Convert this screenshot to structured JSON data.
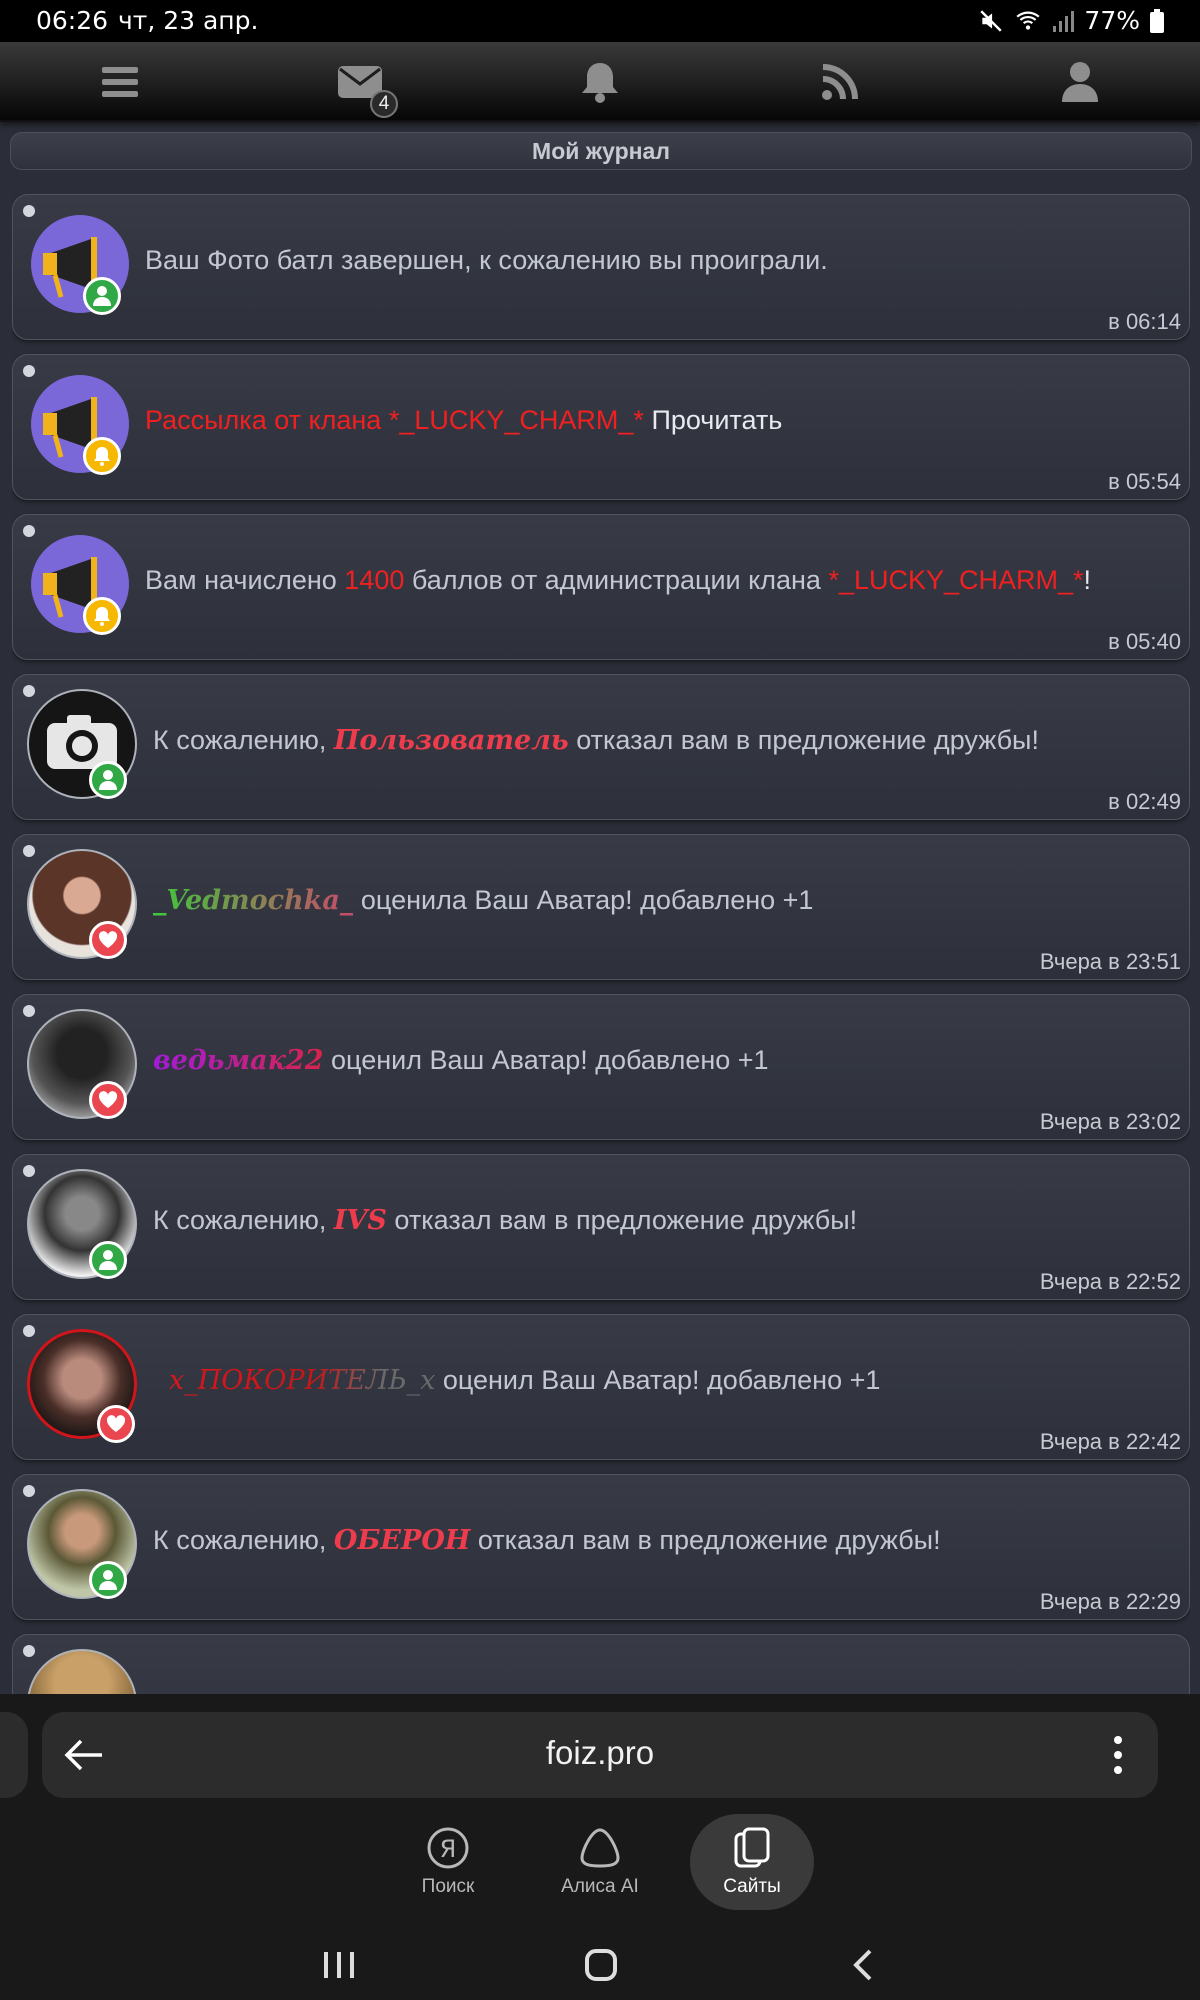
{
  "status": {
    "time": "06:26",
    "date": "чт, 23 апр.",
    "battery": "77%"
  },
  "nav": {
    "mail_badge": "4",
    "icons": [
      "menu-icon",
      "mail-icon",
      "bell-icon",
      "rss-icon",
      "user-icon"
    ]
  },
  "page": {
    "title": "Мой журнал"
  },
  "items": [
    {
      "time": "в 06:14",
      "text": "Ваш Фото батл завершен, к сожалению вы проиграли."
    },
    {
      "time": "в 05:54",
      "red": "Рассылка от клана *_LUCKY_CHARM_*",
      "link": "Прочитать"
    },
    {
      "time": "в 05:40",
      "t1": "Вам начислено ",
      "points": "1400",
      "t2": " баллов от администрации клана ",
      "clan": "*_LUCKY_CHARM_*",
      "t3": "!"
    },
    {
      "time": "в 02:49",
      "pre": "К сожалению, ",
      "nick": "Пользователь",
      "post": " отказал вам в предложение дружбы!"
    },
    {
      "time": "Вчера в 23:51",
      "nick": "_Vedmochka_",
      "post": " оценила Ваш Аватар! добавлено +1"
    },
    {
      "time": "Вчера в 23:02",
      "nick": "ведьмак22",
      "post": " оценил Ваш Аватар! добавлено +1"
    },
    {
      "time": "Вчера в 22:52",
      "pre": "К сожалению, ",
      "nick": "IVS",
      "post": " отказал вам в предложение дружбы!"
    },
    {
      "time": "Вчера в 22:42",
      "nick": "x_ПОКОРИТЕЛЬ_x",
      "post": " оценил Ваш Аватар! добавлено +1"
    },
    {
      "time": "Вчера в 22:29",
      "pre": "К сожалению, ",
      "nick": "ОБЕРОН",
      "post": " отказал вам в предложение дружбы!"
    }
  ],
  "browser": {
    "url": "foiz.pro",
    "tabs": [
      "Поиск",
      "Алиса AI",
      "Сайты"
    ]
  }
}
